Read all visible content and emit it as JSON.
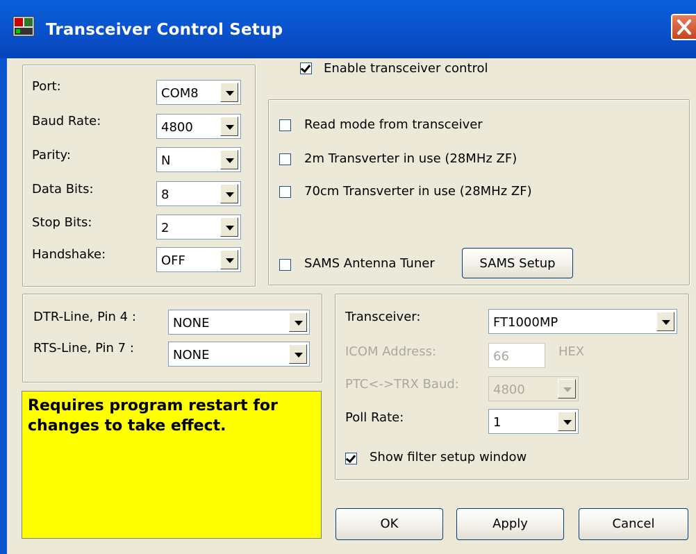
{
  "window": {
    "title": "Transceiver Control Setup"
  },
  "enable_control": {
    "label": "Enable transceiver control",
    "checked": true
  },
  "serial": {
    "fields": [
      {
        "label": "Port:",
        "value": "COM8"
      },
      {
        "label": "Baud Rate:",
        "value": "4800"
      },
      {
        "label": "Parity:",
        "value": "N"
      },
      {
        "label": "Data Bits:",
        "value": "8"
      },
      {
        "label": "Stop Bits:",
        "value": "2"
      },
      {
        "label": "Handshake:",
        "value": "OFF"
      }
    ]
  },
  "options": {
    "read_mode": {
      "label": "Read mode from transceiver",
      "checked": false
    },
    "transverter_2m": {
      "label": "2m Transverter in use (28MHz ZF)",
      "checked": false
    },
    "transverter_70cm": {
      "label": "70cm Transverter in use (28MHz ZF)",
      "checked": false
    },
    "sams_tuner": {
      "label": "SAMS Antenna Tuner",
      "checked": false
    },
    "sams_setup_label": "SAMS Setup"
  },
  "lines": {
    "dtr": {
      "label": "DTR-Line, Pin 4 :",
      "value": "NONE"
    },
    "rts": {
      "label": "RTS-Line, Pin 7 :",
      "value": "NONE"
    }
  },
  "note": "Requires program restart for changes to take effect.",
  "transceiver": {
    "label": "Transceiver:",
    "value": "FT1000MP",
    "icom_label": "ICOM Address:",
    "icom_value": "66",
    "icom_unit": "HEX",
    "ptc_label": "PTC<->TRX Baud:",
    "ptc_value": "4800",
    "poll_label": "Poll Rate:",
    "poll_value": "1",
    "show_filter": {
      "label": "Show filter setup window",
      "checked": true
    }
  },
  "buttons": {
    "ok": "OK",
    "apply": "Apply",
    "cancel": "Cancel"
  },
  "colors": {
    "title_bar": "#0a55cf",
    "note_bg": "#ffff00",
    "dialog_bg": "#ece9d8"
  }
}
